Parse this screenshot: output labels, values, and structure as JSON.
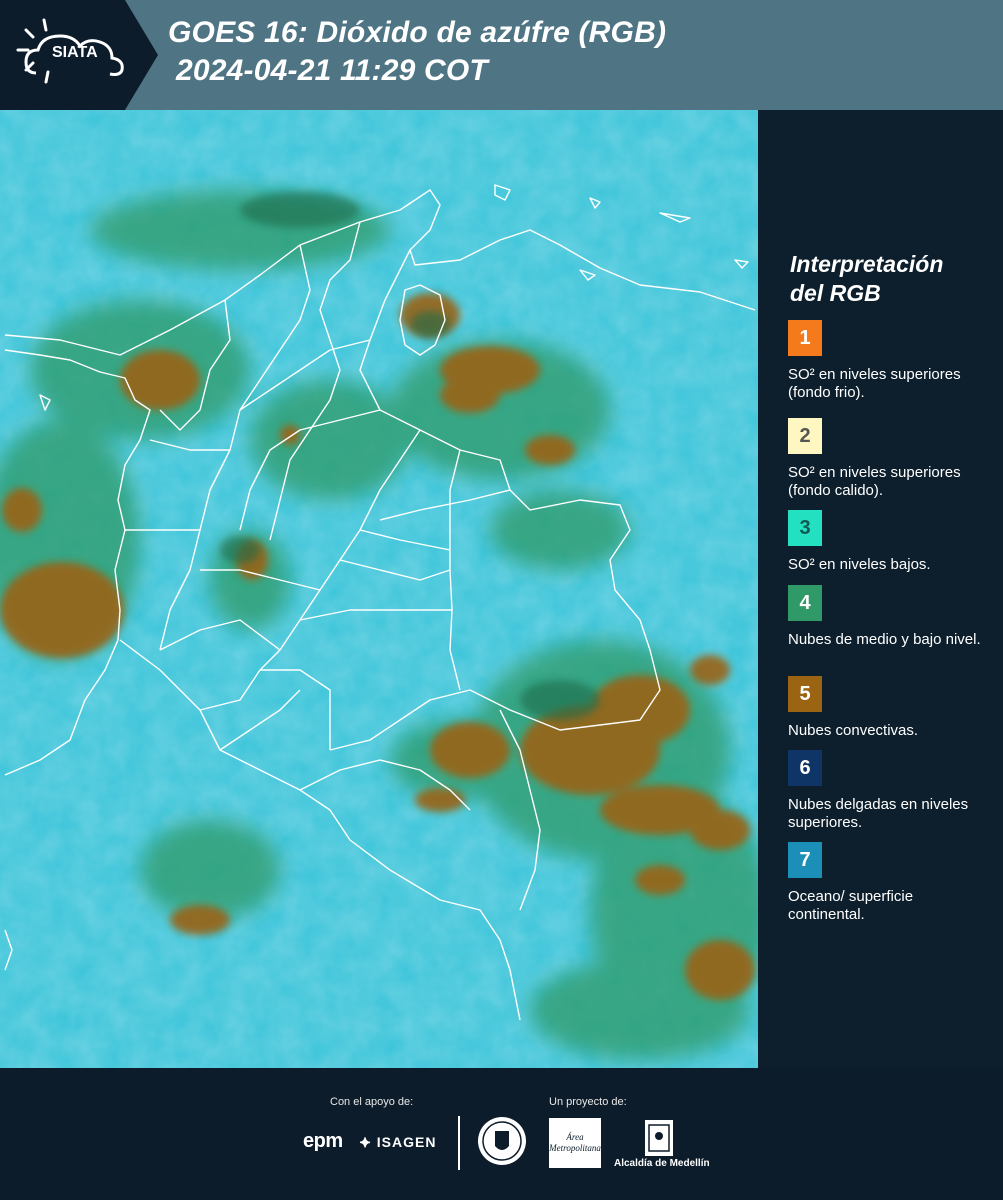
{
  "header": {
    "logo_text": "SIATA",
    "title_line1": "GOES 16: Dióxido de azúfre (RGB)",
    "title_line2": "2024-04-21 11:29 COT"
  },
  "legend": {
    "title_line1": "Interpretación",
    "title_line2": "del RGB",
    "items": [
      {
        "number": "1",
        "label": "SO² en niveles superiores (fondo frio).",
        "color": "#f47a1b"
      },
      {
        "number": "2",
        "label": "SO² en niveles superiores (fondo calido).",
        "color": "#fff7c2"
      },
      {
        "number": "3",
        "label": "SO² en niveles bajos.",
        "color": "#22e0c0"
      },
      {
        "number": "4",
        "label": "Nubes de medio y bajo nivel.",
        "color": "#2f9a67"
      },
      {
        "number": "5",
        "label": "Nubes convectivas.",
        "color": "#9a6412"
      },
      {
        "number": "6",
        "label": "Nubes delgadas en niveles superiores.",
        "color": "#0f3566"
      },
      {
        "number": "7",
        "label": "Oceano/ superficie continental.",
        "color": "#1b8fb8"
      }
    ]
  },
  "footer": {
    "support_label": "Con el apoyo de:",
    "project_label": "Un proyecto de:",
    "sponsor_1": "epm",
    "sponsor_2": "ISAGEN",
    "partner_1": "Área Metropolitana",
    "partner_2": "Alcaldía de Medellín"
  },
  "colors": {
    "header_bg": "#4f7585",
    "logo_bg": "#0d1c2b",
    "sidebar_bg": "#0d1f2c",
    "surface": "#3fc5da",
    "low_clouds": "#2f9a67",
    "convective": "#9a6412"
  }
}
